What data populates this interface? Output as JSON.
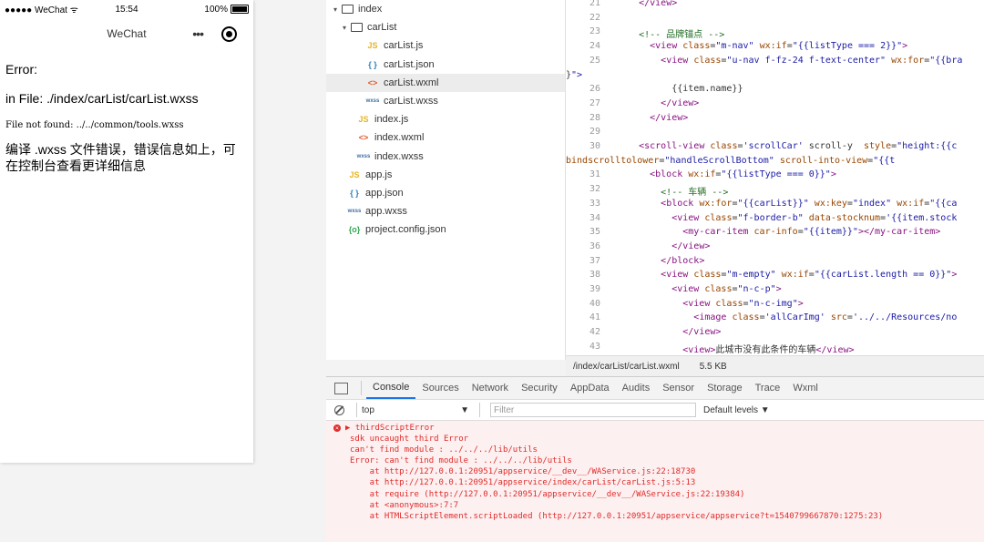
{
  "simulator": {
    "carrier": "●●●●● WeChat",
    "wifi": "ᯤ",
    "time": "15:54",
    "battery": "100%",
    "nav_title": "WeChat",
    "menu_dots": "•••",
    "error_title": "Error:",
    "error_file": "in File: ./index/carList/carList.wxss",
    "error_detail": "File not found: ../../common/tools.wxss",
    "error_message": "编译 .wxss 文件错误，错误信息如上，可在控制台查看更详细信息"
  },
  "filetree": {
    "items": [
      {
        "label": "index",
        "type": "folder",
        "indent": 0,
        "arrow": "▾"
      },
      {
        "label": "carList",
        "type": "folder",
        "indent": 1,
        "arrow": "▾"
      },
      {
        "label": "carList.js",
        "type": "js",
        "indent": 2,
        "icon": "JS"
      },
      {
        "label": "carList.json",
        "type": "json",
        "indent": 2,
        "icon": "{ }"
      },
      {
        "label": "carList.wxml",
        "type": "wxml",
        "indent": 2,
        "icon": "<>"
      },
      {
        "label": "carList.wxss",
        "type": "wxss",
        "indent": 2,
        "icon": "wxss"
      },
      {
        "label": "index.js",
        "type": "js",
        "indent": 1,
        "icon": "JS"
      },
      {
        "label": "index.wxml",
        "type": "wxml",
        "indent": 1,
        "icon": "<>"
      },
      {
        "label": "index.wxss",
        "type": "wxss",
        "indent": 1,
        "icon": "wxss"
      },
      {
        "label": "app.js",
        "type": "js",
        "indent": 0,
        "icon": "JS"
      },
      {
        "label": "app.json",
        "type": "json",
        "indent": 0,
        "icon": "{ }"
      },
      {
        "label": "app.wxss",
        "type": "wxss",
        "indent": 0,
        "icon": "wxss"
      },
      {
        "label": "project.config.json",
        "type": "config",
        "indent": 0,
        "icon": "{o}"
      }
    ]
  },
  "editor": {
    "line_numbers": [
      "21",
      "22",
      "23",
      "24",
      "25",
      "",
      "26",
      "27",
      "28",
      "29",
      "30",
      "",
      "31",
      "32",
      "33",
      "34",
      "35",
      "36",
      "37",
      "38",
      "39",
      "40",
      "41",
      "42",
      "43"
    ],
    "lines": [
      "    </view>",
      "",
      "    <!-- 品牌锚点 -->",
      "      <view class=\"m-nav\" wx:if=\"{{listType === 2}}\">",
      "        <view class=\"u-nav f-fz-24 f-text-center\" wx:for=\"{{bra",
      "}\">",
      "          {{item.name}}",
      "        </view>",
      "      </view>",
      "",
      "    <scroll-view class='scrollCar' scroll-y  style=\"height:{{c",
      "bindscrolltolower=\"handleScrollBottom\" scroll-into-view=\"{{t",
      "      <block wx:if=\"{{listType === 0}}\">",
      "        <!-- 车辆 -->",
      "        <block wx:for=\"{{carList}}\" wx:key=\"index\" wx:if=\"{{ca",
      "          <view class=\"f-border-b\" data-stocknum='{{item.stock",
      "            <my-car-item car-info=\"{{item}}\"></my-car-item>",
      "          </view>",
      "        </block>",
      "        <view class=\"m-empty\" wx:if=\"{{carList.length == 0}}\">",
      "          <view class=\"n-c-p\">",
      "            <view class=\"n-c-img\">",
      "              <image class='allCarImg' src='../../Resources/no",
      "            </view>",
      "            <view>此城市没有此条件的车辆</view>"
    ],
    "file_path": "/index/carList/carList.wxml",
    "file_size": "5.5 KB"
  },
  "devtools": {
    "tabs": [
      "Console",
      "Sources",
      "Network",
      "Security",
      "AppData",
      "Audits",
      "Sensor",
      "Storage",
      "Trace",
      "Wxml"
    ],
    "active_tab": "Console",
    "context": "top",
    "filter_placeholder": "Filter",
    "levels": "Default levels ▼",
    "console_lines": [
      "▶ thirdScriptError",
      "sdk uncaught third Error",
      "can't find module : ../../../lib/utils",
      "Error: can't find module : ../../../lib/utils",
      "    at http://127.0.0.1:20951/appservice/__dev__/WAService.js:22:18730",
      "    at http://127.0.0.1:20951/appservice/index/carList/carList.js:5:13",
      "    at require (http://127.0.0.1:20951/appservice/__dev__/WAService.js:22:19384)",
      "    at <anonymous>:7:7",
      "    at HTMLScriptElement.scriptLoaded (http://127.0.0.1:20951/appservice/appservice?t=1540799667870:1275:23)"
    ]
  }
}
